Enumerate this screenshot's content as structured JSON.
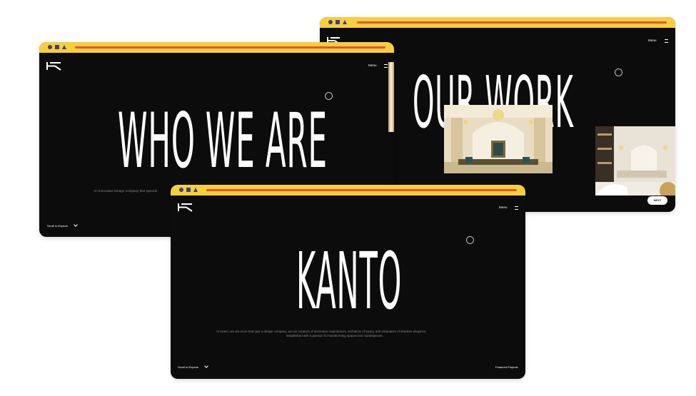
{
  "mockups": {
    "who": {
      "menu_label": "Menu",
      "heading": "WHO WE ARE",
      "tagline": "An Innovative Design company that speciali",
      "scroll_label": "Scroll to Explore"
    },
    "work": {
      "menu_label": "Menu",
      "heading": "OUR WORK",
      "next_label": "NEXT"
    },
    "kanto": {
      "menu_label": "Menu",
      "heading": "KANTO",
      "description_line1": "At Kanto, we are more than just a design company, we are creators of immersive experiences, architects of luxury, and visionaries of timeless elegance.",
      "description_line2": "Established with a passion for transforming spaces into masterpieces.",
      "scroll_label": "Scroll to Explore",
      "featured_label": "Featured Projects"
    }
  },
  "colors": {
    "titlebar": "#f6cf3b",
    "titlebar_bar": "#e8523a",
    "window_controls": "#3b3f8f",
    "background": "#0c0c0c"
  },
  "icons": [
    "logo-icon",
    "hamburger-icon",
    "cursor-ring-icon",
    "chevron-down-icon",
    "circle-control-icon",
    "square-control-icon",
    "triangle-control-icon"
  ]
}
